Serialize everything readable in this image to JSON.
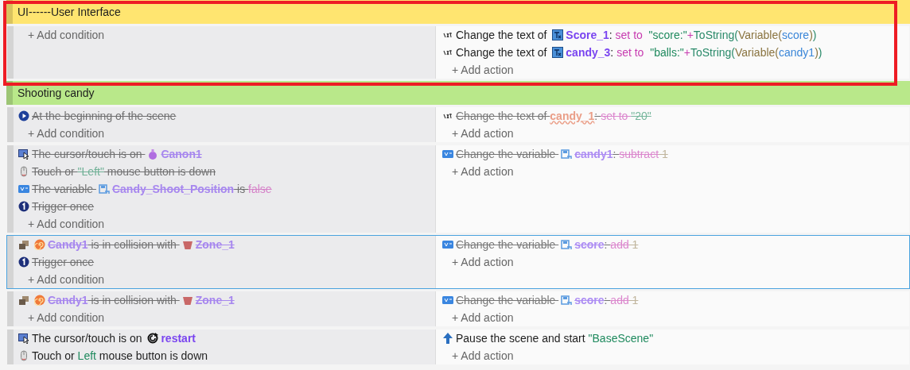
{
  "annotation_frame": true,
  "rows": [
    {
      "kind": "group",
      "title": "UI------User Interface",
      "color": "#ffe570"
    },
    {
      "kind": "event",
      "disabled": false,
      "selected": false,
      "conditions": [],
      "add_condition": "+ Add condition",
      "actions": [
        {
          "kind": "text-action",
          "segments": [
            {
              "kind": "text",
              "text": "Change the text of "
            },
            {
              "kind": "object-text-object",
              "text": "Score_1"
            },
            {
              "kind": "text",
              "text": ": "
            },
            {
              "kind": "keyword",
              "text": "set to "
            },
            {
              "kind": "string",
              "text": " \"score:\""
            },
            {
              "kind": "keyword",
              "text": "+"
            },
            {
              "kind": "function",
              "text": "ToString("
            },
            {
              "kind": "builtin",
              "text": "Variable("
            },
            {
              "kind": "variable",
              "text": "score"
            },
            {
              "kind": "builtin",
              "text": ")"
            },
            {
              "kind": "function",
              "text": ")"
            }
          ]
        },
        {
          "kind": "text-action",
          "segments": [
            {
              "kind": "text",
              "text": "Change the text of "
            },
            {
              "kind": "object-text-object",
              "text": "candy_3"
            },
            {
              "kind": "text",
              "text": ": "
            },
            {
              "kind": "keyword",
              "text": "set to "
            },
            {
              "kind": "string",
              "text": " \"balls:\""
            },
            {
              "kind": "keyword",
              "text": "+"
            },
            {
              "kind": "function",
              "text": "ToString("
            },
            {
              "kind": "builtin",
              "text": "Variable("
            },
            {
              "kind": "variable",
              "text": "candy1"
            },
            {
              "kind": "builtin",
              "text": ")"
            },
            {
              "kind": "function",
              "text": ")"
            }
          ]
        }
      ],
      "add_action": "+ Add action"
    },
    {
      "kind": "group",
      "title": "Shooting candy",
      "color": "#b9e88a"
    },
    {
      "kind": "event",
      "disabled": true,
      "selected": false,
      "conditions": [
        {
          "kind": "scene-start",
          "segments": [
            {
              "kind": "text",
              "text": "At the beginning of the scene"
            }
          ]
        }
      ],
      "add_condition": "+ Add condition",
      "actions": [
        {
          "kind": "text-action",
          "segments": [
            {
              "kind": "text",
              "text": "Change the text of "
            },
            {
              "kind": "error",
              "text": "candy_1"
            },
            {
              "kind": "text",
              "text": ": "
            },
            {
              "kind": "keyword",
              "text": "set to "
            },
            {
              "kind": "string",
              "text": "\"20\""
            }
          ]
        }
      ],
      "add_action": "+ Add action"
    },
    {
      "kind": "event",
      "disabled": true,
      "selected": false,
      "conditions": [
        {
          "kind": "cursor",
          "segments": [
            {
              "kind": "text",
              "text": "The cursor/touch is on "
            },
            {
              "kind": "object-potion",
              "text": "Canon1"
            }
          ]
        },
        {
          "kind": "mouse",
          "segments": [
            {
              "kind": "text",
              "text": "Touch or "
            },
            {
              "kind": "string",
              "text": "\"Left\""
            },
            {
              "kind": "text",
              "text": " mouse button is down"
            }
          ]
        },
        {
          "kind": "variable",
          "segments": [
            {
              "kind": "text",
              "text": "The variable "
            },
            {
              "kind": "object-scene-variable",
              "text": "Candy_Shoot_Position"
            },
            {
              "kind": "text",
              "text": " is "
            },
            {
              "kind": "keyword",
              "text": "false"
            }
          ]
        },
        {
          "kind": "trigger-once",
          "segments": [
            {
              "kind": "text",
              "text": "Trigger once"
            }
          ]
        }
      ],
      "add_condition": "+ Add condition",
      "actions": [
        {
          "kind": "variable",
          "segments": [
            {
              "kind": "text",
              "text": "Change the variable "
            },
            {
              "kind": "object-scene-variable",
              "text": "candy1"
            },
            {
              "kind": "text",
              "text": ": "
            },
            {
              "kind": "keyword",
              "text": "subtract"
            },
            {
              "kind": "number",
              "text": " 1"
            }
          ]
        }
      ],
      "add_action": "+ Add action"
    },
    {
      "kind": "event",
      "disabled": true,
      "selected": true,
      "conditions": [
        {
          "kind": "collision",
          "segments": [
            {
              "kind": "object-candy",
              "text": "Candy1"
            },
            {
              "kind": "text",
              "text": " is in collision with "
            },
            {
              "kind": "object-zone",
              "text": "Zone_1"
            }
          ]
        },
        {
          "kind": "trigger-once",
          "segments": [
            {
              "kind": "text",
              "text": "Trigger once"
            }
          ]
        }
      ],
      "add_condition": "+ Add condition",
      "actions": [
        {
          "kind": "variable",
          "segments": [
            {
              "kind": "text",
              "text": "Change the variable "
            },
            {
              "kind": "object-scene-variable",
              "text": "score"
            },
            {
              "kind": "text",
              "text": ": "
            },
            {
              "kind": "keyword",
              "text": "add"
            },
            {
              "kind": "number",
              "text": " 1"
            }
          ]
        }
      ],
      "add_action": "+ Add action"
    },
    {
      "kind": "event",
      "disabled": true,
      "selected": false,
      "conditions": [
        {
          "kind": "collision",
          "segments": [
            {
              "kind": "object-candy",
              "text": "Candy1"
            },
            {
              "kind": "text",
              "text": " is in collision with "
            },
            {
              "kind": "object-zone",
              "text": "Zone_1"
            }
          ]
        }
      ],
      "add_condition": "+ Add condition",
      "actions": [
        {
          "kind": "variable",
          "segments": [
            {
              "kind": "text",
              "text": "Change the variable "
            },
            {
              "kind": "object-scene-variable",
              "text": "score"
            },
            {
              "kind": "text",
              "text": ": "
            },
            {
              "kind": "keyword",
              "text": "add"
            },
            {
              "kind": "number",
              "text": " 1"
            }
          ]
        }
      ],
      "add_action": "+ Add action"
    },
    {
      "kind": "event",
      "disabled": false,
      "selected": false,
      "conditions": [
        {
          "kind": "cursor",
          "segments": [
            {
              "kind": "text",
              "text": "The cursor/touch is on "
            },
            {
              "kind": "object-restart",
              "text": "restart"
            }
          ]
        },
        {
          "kind": "mouse",
          "segments": [
            {
              "kind": "text",
              "text": "Touch or "
            },
            {
              "kind": "string",
              "text": "Left"
            },
            {
              "kind": "text",
              "text": " mouse button is down"
            }
          ]
        }
      ],
      "actions": [
        {
          "kind": "scene-push",
          "segments": [
            {
              "kind": "text",
              "text": "Pause the scene and start "
            },
            {
              "kind": "string",
              "text": "\"BaseScene\""
            }
          ]
        }
      ],
      "add_action": "+ Add action"
    }
  ]
}
